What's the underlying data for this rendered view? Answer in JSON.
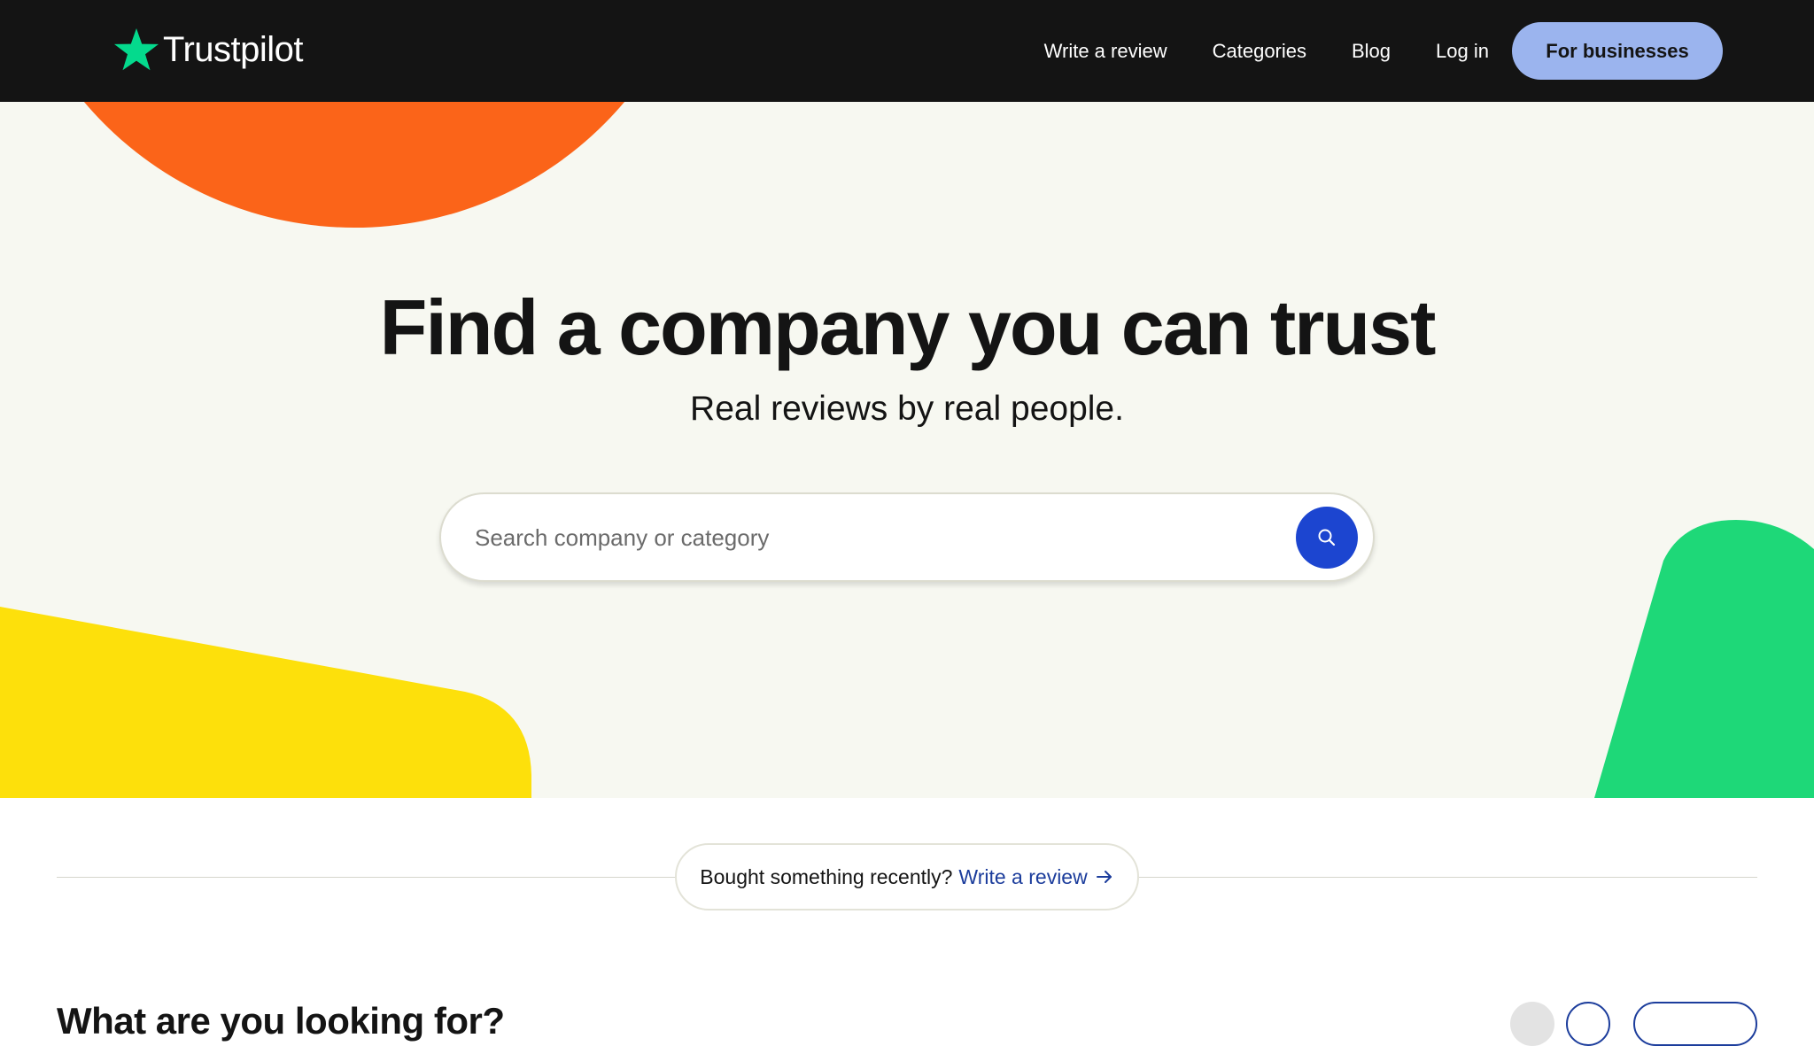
{
  "header": {
    "logo_text": "Trustpilot",
    "nav": [
      {
        "label": "Write a review"
      },
      {
        "label": "Categories"
      },
      {
        "label": "Blog"
      },
      {
        "label": "Log in"
      }
    ],
    "business_button": "For businesses"
  },
  "hero": {
    "title": "Find a company you can trust",
    "subtitle": "Real reviews by real people.",
    "search": {
      "placeholder": "Search company or category",
      "value": "",
      "button_icon": "search-icon"
    }
  },
  "review_prompt": {
    "question": "Bought something recently?",
    "link_label": "Write a review",
    "link_icon": "arrow-right-icon"
  },
  "categories_section": {
    "title": "What are you looking for?"
  },
  "colors": {
    "header_bg": "#141414",
    "hero_bg": "#f7f8f1",
    "brand_green": "#04da8d",
    "accent_blue": "#1c45d0",
    "business_button": "#9bb4ee",
    "orange_shape": "#fb6419",
    "yellow_shape": "#fde00b",
    "green_shape": "#1ed878",
    "link_blue": "#1c3d9c"
  }
}
